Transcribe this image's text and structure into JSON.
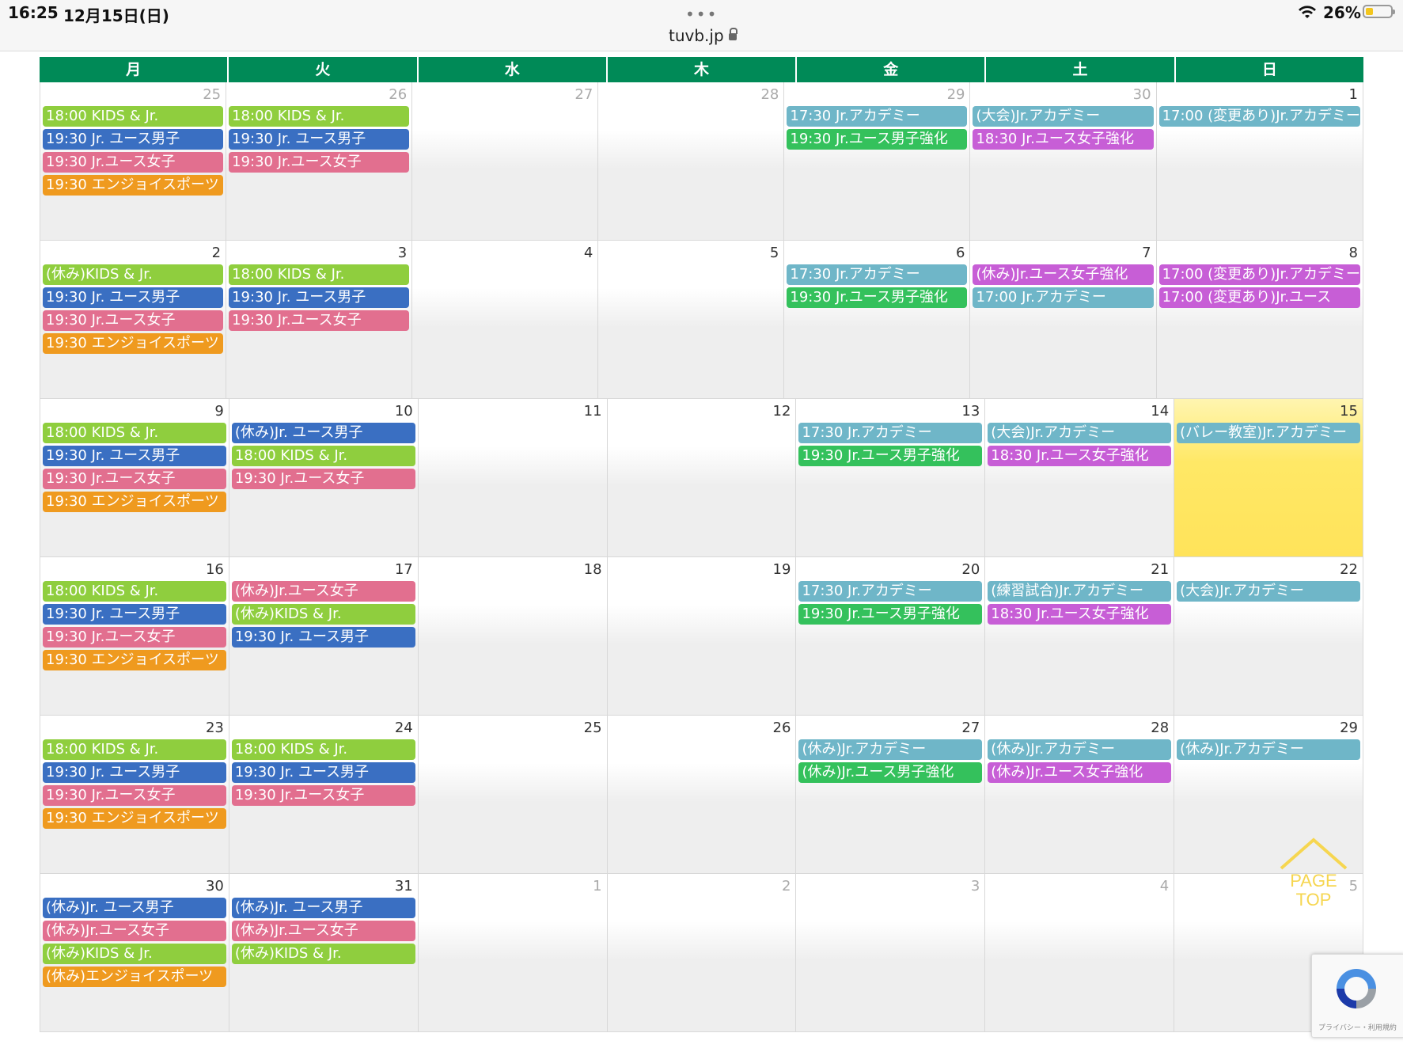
{
  "statusbar": {
    "time": "16:25",
    "date": "12月15日(日)",
    "dots": "•••",
    "url": "tuvb.jp",
    "battery_pct": "26%"
  },
  "colors": {
    "header": "#008a57",
    "green": "#8fce3e",
    "blue": "#3a6fc2",
    "pink": "#e26f8f",
    "orange": "#ef9a1f",
    "teal": "#6fb6c8",
    "dgreen": "#34c15c",
    "purple": "#c75ed6"
  },
  "weekdays": [
    "月",
    "火",
    "水",
    "木",
    "金",
    "土",
    "日"
  ],
  "weeks": [
    {
      "days": [
        {
          "num": "25",
          "other": true,
          "events": [
            {
              "t": "18:00 KIDS & Jr.",
              "c": "green"
            },
            {
              "t": "19:30 Jr. ユース男子",
              "c": "blue"
            },
            {
              "t": "19:30 Jr.ユース女子",
              "c": "pink"
            },
            {
              "t": "19:30 エンジョイスポーツ",
              "c": "orange"
            }
          ]
        },
        {
          "num": "26",
          "other": true,
          "events": [
            {
              "t": "18:00 KIDS & Jr.",
              "c": "green"
            },
            {
              "t": "19:30 Jr. ユース男子",
              "c": "blue"
            },
            {
              "t": "19:30 Jr.ユース女子",
              "c": "pink"
            }
          ]
        },
        {
          "num": "27",
          "other": true,
          "events": []
        },
        {
          "num": "28",
          "other": true,
          "events": []
        },
        {
          "num": "29",
          "other": true,
          "events": [
            {
              "t": "17:30 Jr.アカデミー",
              "c": "teal"
            },
            {
              "t": "19:30 Jr.ユース男子強化",
              "c": "dgreen"
            }
          ]
        },
        {
          "num": "30",
          "other": true,
          "events": [
            {
              "t": "(大会)Jr.アカデミー",
              "c": "teal"
            },
            {
              "t": "18:30 Jr.ユース女子強化",
              "c": "purple"
            }
          ]
        },
        {
          "num": "1",
          "other": false,
          "events": [
            {
              "t": "17:00 (変更あり)Jr.アカデミー",
              "c": "teal"
            }
          ]
        }
      ]
    },
    {
      "days": [
        {
          "num": "2",
          "events": [
            {
              "t": "(休み)KIDS & Jr.",
              "c": "green"
            },
            {
              "t": "19:30 Jr. ユース男子",
              "c": "blue"
            },
            {
              "t": "19:30 Jr.ユース女子",
              "c": "pink"
            },
            {
              "t": "19:30 エンジョイスポーツ",
              "c": "orange"
            }
          ]
        },
        {
          "num": "3",
          "events": [
            {
              "t": "18:00 KIDS & Jr.",
              "c": "green"
            },
            {
              "t": "19:30 Jr. ユース男子",
              "c": "blue"
            },
            {
              "t": "19:30 Jr.ユース女子",
              "c": "pink"
            }
          ]
        },
        {
          "num": "4",
          "events": []
        },
        {
          "num": "5",
          "events": []
        },
        {
          "num": "6",
          "events": [
            {
              "t": "17:30 Jr.アカデミー",
              "c": "teal"
            },
            {
              "t": "19:30 Jr.ユース男子強化",
              "c": "dgreen"
            }
          ]
        },
        {
          "num": "7",
          "events": [
            {
              "t": "(休み)Jr.ユース女子強化",
              "c": "purple"
            },
            {
              "t": "17:00 Jr.アカデミー",
              "c": "teal"
            }
          ]
        },
        {
          "num": "8",
          "events": [
            {
              "t": "17:00 (変更あり)Jr.アカデミー",
              "c": "purple"
            },
            {
              "t": "17:00 (変更あり)Jr.ユース",
              "c": "purple"
            }
          ]
        }
      ]
    },
    {
      "days": [
        {
          "num": "9",
          "events": [
            {
              "t": "18:00 KIDS & Jr.",
              "c": "green"
            },
            {
              "t": "19:30 Jr. ユース男子",
              "c": "blue"
            },
            {
              "t": "19:30 Jr.ユース女子",
              "c": "pink"
            },
            {
              "t": "19:30 エンジョイスポーツ",
              "c": "orange"
            }
          ]
        },
        {
          "num": "10",
          "events": [
            {
              "t": "(休み)Jr. ユース男子",
              "c": "blue"
            },
            {
              "t": "18:00 KIDS & Jr.",
              "c": "green"
            },
            {
              "t": "19:30 Jr.ユース女子",
              "c": "pink"
            }
          ]
        },
        {
          "num": "11",
          "events": []
        },
        {
          "num": "12",
          "events": []
        },
        {
          "num": "13",
          "events": [
            {
              "t": "17:30 Jr.アカデミー",
              "c": "teal"
            },
            {
              "t": "19:30 Jr.ユース男子強化",
              "c": "dgreen"
            }
          ]
        },
        {
          "num": "14",
          "events": [
            {
              "t": "(大会)Jr.アカデミー",
              "c": "teal"
            },
            {
              "t": "18:30 Jr.ユース女子強化",
              "c": "purple"
            }
          ]
        },
        {
          "num": "15",
          "today": true,
          "events": [
            {
              "t": "(バレー教室)Jr.アカデミー",
              "c": "teal"
            }
          ]
        }
      ]
    },
    {
      "days": [
        {
          "num": "16",
          "events": [
            {
              "t": "18:00 KIDS & Jr.",
              "c": "green"
            },
            {
              "t": "19:30 Jr. ユース男子",
              "c": "blue"
            },
            {
              "t": "19:30 Jr.ユース女子",
              "c": "pink"
            },
            {
              "t": "19:30 エンジョイスポーツ",
              "c": "orange"
            }
          ]
        },
        {
          "num": "17",
          "events": [
            {
              "t": "(休み)Jr.ユース女子",
              "c": "pink"
            },
            {
              "t": "(休み)KIDS & Jr.",
              "c": "green"
            },
            {
              "t": "19:30 Jr. ユース男子",
              "c": "blue"
            }
          ]
        },
        {
          "num": "18",
          "events": []
        },
        {
          "num": "19",
          "events": []
        },
        {
          "num": "20",
          "events": [
            {
              "t": "17:30 Jr.アカデミー",
              "c": "teal"
            },
            {
              "t": "19:30 Jr.ユース男子強化",
              "c": "dgreen"
            }
          ]
        },
        {
          "num": "21",
          "events": [
            {
              "t": "(練習試合)Jr.アカデミー",
              "c": "teal"
            },
            {
              "t": "18:30 Jr.ユース女子強化",
              "c": "purple"
            }
          ]
        },
        {
          "num": "22",
          "events": [
            {
              "t": "(大会)Jr.アカデミー",
              "c": "teal"
            }
          ]
        }
      ]
    },
    {
      "days": [
        {
          "num": "23",
          "events": [
            {
              "t": "18:00 KIDS & Jr.",
              "c": "green"
            },
            {
              "t": "19:30 Jr. ユース男子",
              "c": "blue"
            },
            {
              "t": "19:30 Jr.ユース女子",
              "c": "pink"
            },
            {
              "t": "19:30 エンジョイスポーツ",
              "c": "orange"
            }
          ]
        },
        {
          "num": "24",
          "events": [
            {
              "t": "18:00 KIDS & Jr.",
              "c": "green"
            },
            {
              "t": "19:30 Jr. ユース男子",
              "c": "blue"
            },
            {
              "t": "19:30 Jr.ユース女子",
              "c": "pink"
            }
          ]
        },
        {
          "num": "25",
          "events": []
        },
        {
          "num": "26",
          "events": []
        },
        {
          "num": "27",
          "events": [
            {
              "t": "(休み)Jr.アカデミー",
              "c": "teal"
            },
            {
              "t": "(休み)Jr.ユース男子強化",
              "c": "dgreen"
            }
          ]
        },
        {
          "num": "28",
          "events": [
            {
              "t": "(休み)Jr.アカデミー",
              "c": "teal"
            },
            {
              "t": "(休み)Jr.ユース女子強化",
              "c": "purple"
            }
          ]
        },
        {
          "num": "29",
          "events": [
            {
              "t": "(休み)Jr.アカデミー",
              "c": "teal"
            }
          ]
        }
      ]
    },
    {
      "days": [
        {
          "num": "30",
          "events": [
            {
              "t": "(休み)Jr. ユース男子",
              "c": "blue"
            },
            {
              "t": "(休み)Jr.ユース女子",
              "c": "pink"
            },
            {
              "t": "(休み)KIDS & Jr.",
              "c": "green"
            },
            {
              "t": "(休み)エンジョイスポーツ",
              "c": "orange"
            }
          ]
        },
        {
          "num": "31",
          "events": [
            {
              "t": "(休み)Jr. ユース男子",
              "c": "blue"
            },
            {
              "t": "(休み)Jr.ユース女子",
              "c": "pink"
            },
            {
              "t": "(休み)KIDS & Jr.",
              "c": "green"
            }
          ]
        },
        {
          "num": "1",
          "other": true,
          "events": []
        },
        {
          "num": "2",
          "other": true,
          "events": []
        },
        {
          "num": "3",
          "other": true,
          "events": []
        },
        {
          "num": "4",
          "other": true,
          "events": []
        },
        {
          "num": "5",
          "other": true,
          "events": []
        }
      ]
    }
  ],
  "page_top": {
    "line1": "PAGE",
    "line2": "TOP"
  },
  "recaptcha": {
    "text": "プライバシー・利用規約"
  }
}
